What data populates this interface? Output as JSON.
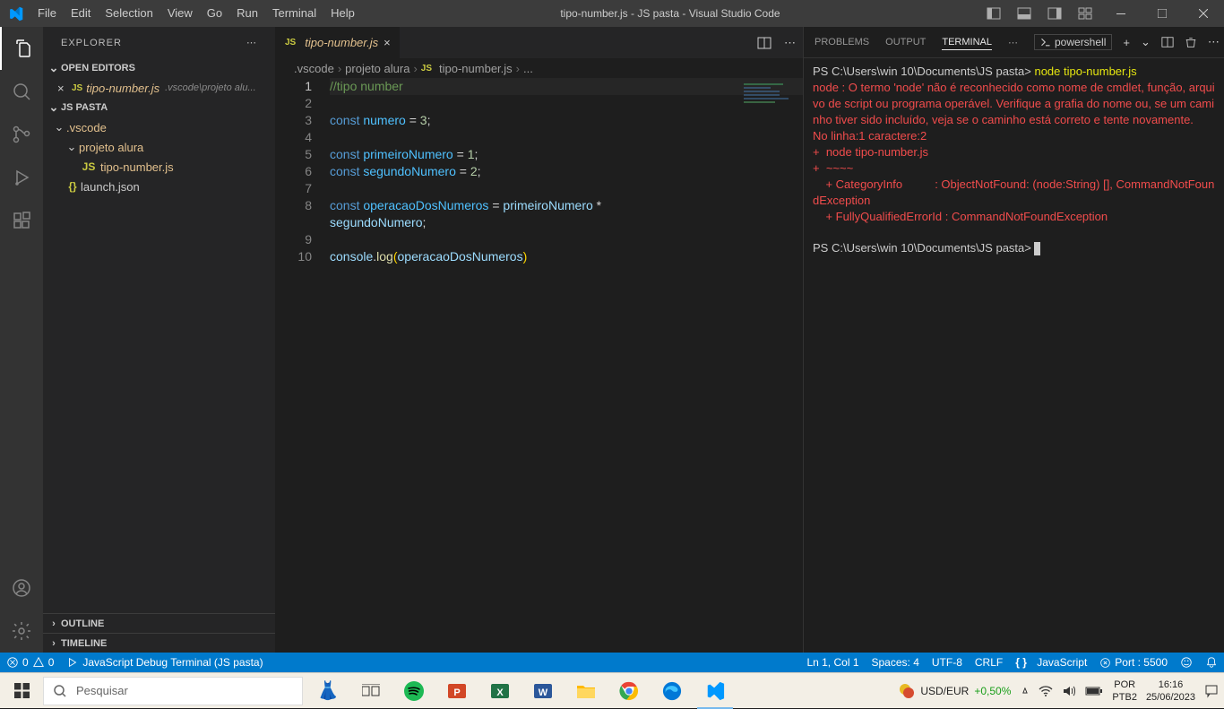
{
  "titlebar": {
    "menus": [
      "File",
      "Edit",
      "Selection",
      "View",
      "Go",
      "Run",
      "Terminal",
      "Help"
    ],
    "title": "tipo-number.js - JS pasta - Visual Studio Code"
  },
  "sidebar": {
    "title": "EXPLORER",
    "open_editors": "OPEN EDITORS",
    "open_file": {
      "name": "tipo-number.js",
      "path": ".vscode\\projeto alu..."
    },
    "workspace": "JS PASTA",
    "tree": {
      "folder1": ".vscode",
      "folder2": "projeto alura",
      "file1": "tipo-number.js",
      "file2": "launch.json"
    },
    "outline": "OUTLINE",
    "timeline": "TIMELINE"
  },
  "tab": {
    "name": "tipo-number.js"
  },
  "breadcrumbs": {
    "p1": ".vscode",
    "p2": "projeto alura",
    "p3": "tipo-number.js",
    "p4": "..."
  },
  "code": {
    "l1": "//tipo number",
    "l3_kw": "const",
    "l3_var": "numero",
    "l3_eq": " = ",
    "l3_val": "3",
    "l3_sc": ";",
    "l5_kw": "const",
    "l5_var": "primeiroNumero",
    "l5_eq": " = ",
    "l5_val": "1",
    "l5_sc": ";",
    "l6_kw": "const",
    "l6_var": "segundoNumero",
    "l6_eq": " = ",
    "l6_val": "2",
    "l6_sc": ";",
    "l8_kw": "const",
    "l8_var": "operacaoDosNumeros",
    "l8_eq": " = ",
    "l8_a": "primeiroNumero",
    "l8_op": " * ",
    "l8b_var": "segundoNumero",
    "l8b_sc": ";",
    "l10_obj": "console",
    "l10_dot": ".",
    "l10_fn": "log",
    "l10_op": "(",
    "l10_arg": "operacaoDosNumeros",
    "l10_cp": ")"
  },
  "panel": {
    "tabs": {
      "problems": "PROBLEMS",
      "output": "OUTPUT",
      "terminal": "TERMINAL"
    },
    "shell": "powershell"
  },
  "terminal": {
    "prompt1": "PS C:\\Users\\win 10\\Documents\\JS pasta> ",
    "cmd1": "node tipo-number.js",
    "err1": "node : O termo 'node' não é reconhecido como nome de cmdlet, função, arquivo de script ou programa operável. Verifique a grafia do nome ou, se um caminho tiver sido incluído, veja se o caminho está correto e tente novamente.",
    "err2": "No linha:1 caractere:2",
    "err3": "+  node tipo-number.js",
    "err4": "+  ~~~~",
    "err5": "    + CategoryInfo          : ObjectNotFound: (node:String) [], CommandNotFoundException",
    "err6": "    + FullyQualifiedErrorId : CommandNotFoundException",
    "prompt2": "PS C:\\Users\\win 10\\Documents\\JS pasta> "
  },
  "statusbar": {
    "errors": "0",
    "warnings": "0",
    "debug": "JavaScript Debug Terminal (JS pasta)",
    "lncol": "Ln 1, Col 1",
    "spaces": "Spaces: 4",
    "encoding": "UTF-8",
    "eol": "CRLF",
    "lang": "JavaScript",
    "port": "Port : 5500"
  },
  "taskbar": {
    "search": "Pesquisar",
    "stock_pair": "USD/EUR",
    "stock_pct": "+0,50%",
    "lang1": "POR",
    "lang2": "PTB2",
    "time": "16:16",
    "date": "25/06/2023"
  }
}
